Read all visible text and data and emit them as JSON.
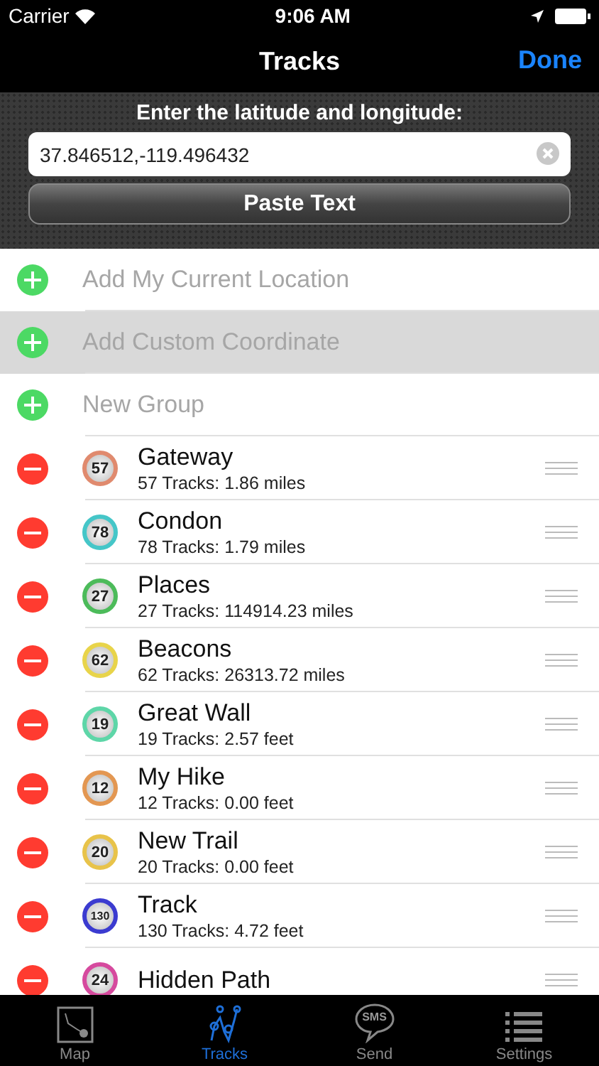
{
  "status_bar": {
    "carrier": "Carrier",
    "time": "9:06 AM"
  },
  "nav": {
    "title": "Tracks",
    "done": "Done"
  },
  "entry": {
    "prompt": "Enter the latitude and longitude:",
    "value": "37.846512,-119.496432",
    "paste_button": "Paste Text"
  },
  "add_rows": [
    {
      "label": "Add My Current Location",
      "selected": false
    },
    {
      "label": "Add Custom Coordinate",
      "selected": true
    },
    {
      "label": "New Group",
      "selected": false
    }
  ],
  "groups": [
    {
      "name": "Gateway",
      "count": "57",
      "detail": "57 Tracks: 1.86 miles",
      "color": "#e08a6e"
    },
    {
      "name": "Condon",
      "count": "78",
      "detail": "78 Tracks: 1.79 miles",
      "color": "#45c6c8"
    },
    {
      "name": "Places",
      "count": "27",
      "detail": "27 Tracks: 114914.23 miles",
      "color": "#4cbb5a"
    },
    {
      "name": "Beacons",
      "count": "62",
      "detail": "62 Tracks: 26313.72 miles",
      "color": "#e8d44a"
    },
    {
      "name": "Great Wall",
      "count": "19",
      "detail": "19 Tracks: 2.57 feet",
      "color": "#5ed6a8"
    },
    {
      "name": "My Hike",
      "count": "12",
      "detail": "12 Tracks: 0.00 feet",
      "color": "#e39752"
    },
    {
      "name": "New Trail",
      "count": "20",
      "detail": "20 Tracks: 0.00 feet",
      "color": "#e8c34a"
    },
    {
      "name": "Track",
      "count": "130",
      "detail": "130 Tracks: 4.72 feet",
      "color": "#3b3bd0"
    },
    {
      "name": "Hidden Path",
      "count": "24",
      "color": "#d64a9e"
    }
  ],
  "tabs": [
    {
      "kind": "map",
      "label": "Map",
      "selected": false
    },
    {
      "kind": "tracks",
      "label": "Tracks",
      "selected": true
    },
    {
      "kind": "sms",
      "label": "Send",
      "icon_text": "SMS",
      "selected": false
    },
    {
      "kind": "settings",
      "label": "Settings",
      "selected": false
    }
  ]
}
